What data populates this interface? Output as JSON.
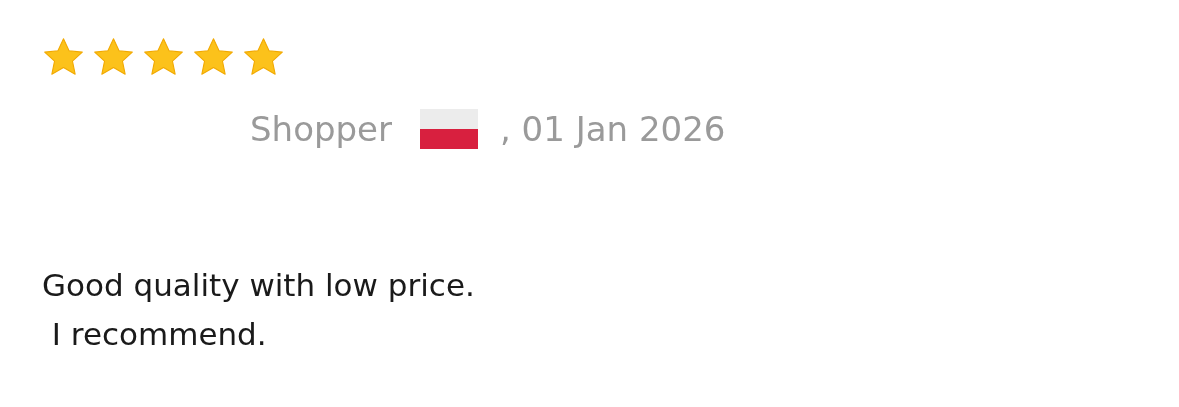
{
  "review": {
    "stars": 5,
    "author": "Shopper",
    "date": ", 01 Jan 2026",
    "text": "Good quality with low price.\n I recommend."
  }
}
